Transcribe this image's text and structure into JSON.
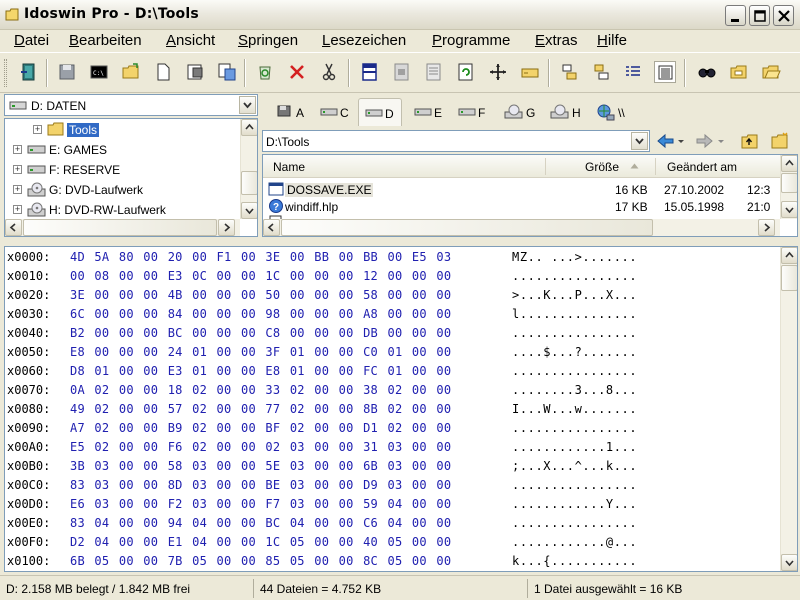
{
  "window": {
    "title": "Idoswin Pro - D:\\Tools"
  },
  "menu": [
    "Datei",
    "Bearbeiten",
    "Ansicht",
    "Springen",
    "Lesezeichen",
    "Programme",
    "Extras",
    "Hilfe"
  ],
  "menu_mnemonics": [
    "D",
    "B",
    "A",
    "S",
    "L",
    "P",
    "E",
    "H"
  ],
  "toolbar": {
    "buttons": [
      "exit-icon",
      "save-icon",
      "console-icon",
      "open-folder-icon",
      "new-file-icon",
      "properties-icon",
      "compare-icon",
      "recycle-icon",
      "delete-icon",
      "cut-icon",
      "split-view-icon",
      "split-horizontal-icon",
      "list-view-icon",
      "refresh-icon",
      "move-icon",
      "drive-icon",
      "sort-asc-icon",
      "sort-desc-icon",
      "details-icon",
      "hex-view-icon",
      "search-icon",
      "folder-icon",
      "folder-open-icon"
    ]
  },
  "left_pane": {
    "drive_selector": "D: DATEN",
    "tree": [
      {
        "label": "Tools",
        "selected": true,
        "icon": "folder-icon"
      },
      {
        "label": "E: GAMES",
        "selected": false,
        "icon": "drive-icon"
      },
      {
        "label": "F: RESERVE",
        "selected": false,
        "icon": "drive-icon"
      },
      {
        "label": "G: DVD-Laufwerk",
        "selected": false,
        "icon": "cd-icon"
      },
      {
        "label": "H: DVD-RW-Laufwerk",
        "selected": false,
        "icon": "cd-icon"
      }
    ]
  },
  "right_pane": {
    "drive_tabs": [
      "A",
      "C",
      "D",
      "E",
      "F",
      "G",
      "H",
      "\\\\"
    ],
    "active_tab": "D",
    "path": "D:\\Tools",
    "columns": {
      "name": "Name",
      "size": "Größe",
      "modified": "Geändert am"
    },
    "files": [
      {
        "name": "DOSSAVE.EXE",
        "size": "16 KB",
        "date": "27.10.2002",
        "time": "12:3",
        "icon": "exe-icon",
        "selected": true
      },
      {
        "name": "windiff.hlp",
        "size": "17 KB",
        "date": "15.05.1998",
        "time": "21:0",
        "icon": "help-file-icon",
        "selected": false
      }
    ]
  },
  "hex": {
    "rows": [
      {
        "addr": "x0000:",
        "bytes": "4D 5A 80 00 20 00 F1 00 3E 00 BB 00 BB 00 E5 03",
        "ascii": "MZ.. ...>......."
      },
      {
        "addr": "x0010:",
        "bytes": "00 08 00 00 E3 0C 00 00 1C 00 00 00 12 00 00 00",
        "ascii": "................"
      },
      {
        "addr": "x0020:",
        "bytes": "3E 00 00 00 4B 00 00 00 50 00 00 00 58 00 00 00",
        "ascii": ">...K...P...X..."
      },
      {
        "addr": "x0030:",
        "bytes": "6C 00 00 00 84 00 00 00 98 00 00 00 A8 00 00 00",
        "ascii": "l..............."
      },
      {
        "addr": "x0040:",
        "bytes": "B2 00 00 00 BC 00 00 00 C8 00 00 00 DB 00 00 00",
        "ascii": "................"
      },
      {
        "addr": "x0050:",
        "bytes": "E8 00 00 00 24 01 00 00 3F 01 00 00 C0 01 00 00",
        "ascii": "....$...?......."
      },
      {
        "addr": "x0060:",
        "bytes": "D8 01 00 00 E3 01 00 00 E8 01 00 00 FC 01 00 00",
        "ascii": "................"
      },
      {
        "addr": "x0070:",
        "bytes": "0A 02 00 00 18 02 00 00 33 02 00 00 38 02 00 00",
        "ascii": "........3...8..."
      },
      {
        "addr": "x0080:",
        "bytes": "49 02 00 00 57 02 00 00 77 02 00 00 8B 02 00 00",
        "ascii": "I...W...w......."
      },
      {
        "addr": "x0090:",
        "bytes": "A7 02 00 00 B9 02 00 00 BF 02 00 00 D1 02 00 00",
        "ascii": "................"
      },
      {
        "addr": "x00A0:",
        "bytes": "E5 02 00 00 F6 02 00 00 02 03 00 00 31 03 00 00",
        "ascii": "............1..."
      },
      {
        "addr": "x00B0:",
        "bytes": "3B 03 00 00 58 03 00 00 5E 03 00 00 6B 03 00 00",
        "ascii": ";...X...^...k..."
      },
      {
        "addr": "x00C0:",
        "bytes": "83 03 00 00 8D 03 00 00 BE 03 00 00 D9 03 00 00",
        "ascii": "................"
      },
      {
        "addr": "x00D0:",
        "bytes": "E6 03 00 00 F2 03 00 00 F7 03 00 00 59 04 00 00",
        "ascii": "............Y..."
      },
      {
        "addr": "x00E0:",
        "bytes": "83 04 00 00 94 04 00 00 BC 04 00 00 C6 04 00 00",
        "ascii": "................"
      },
      {
        "addr": "x00F0:",
        "bytes": "D2 04 00 00 E1 04 00 00 1C 05 00 00 40 05 00 00",
        "ascii": "............@..."
      },
      {
        "addr": "x0100:",
        "bytes": "6B 05 00 00 7B 05 00 00 85 05 00 00 8C 05 00 00",
        "ascii": "k...{..........."
      }
    ]
  },
  "status": {
    "disk": "D: 2.158 MB  belegt / 1.842 MB  frei",
    "files": "44 Dateien = 4.752 KB",
    "selection": "1 Datei ausgewählt = 16 KB"
  },
  "colors": {
    "selection": "#316AC5",
    "hex_bytes": "#2020B0",
    "chrome": "#ECE9D8"
  }
}
